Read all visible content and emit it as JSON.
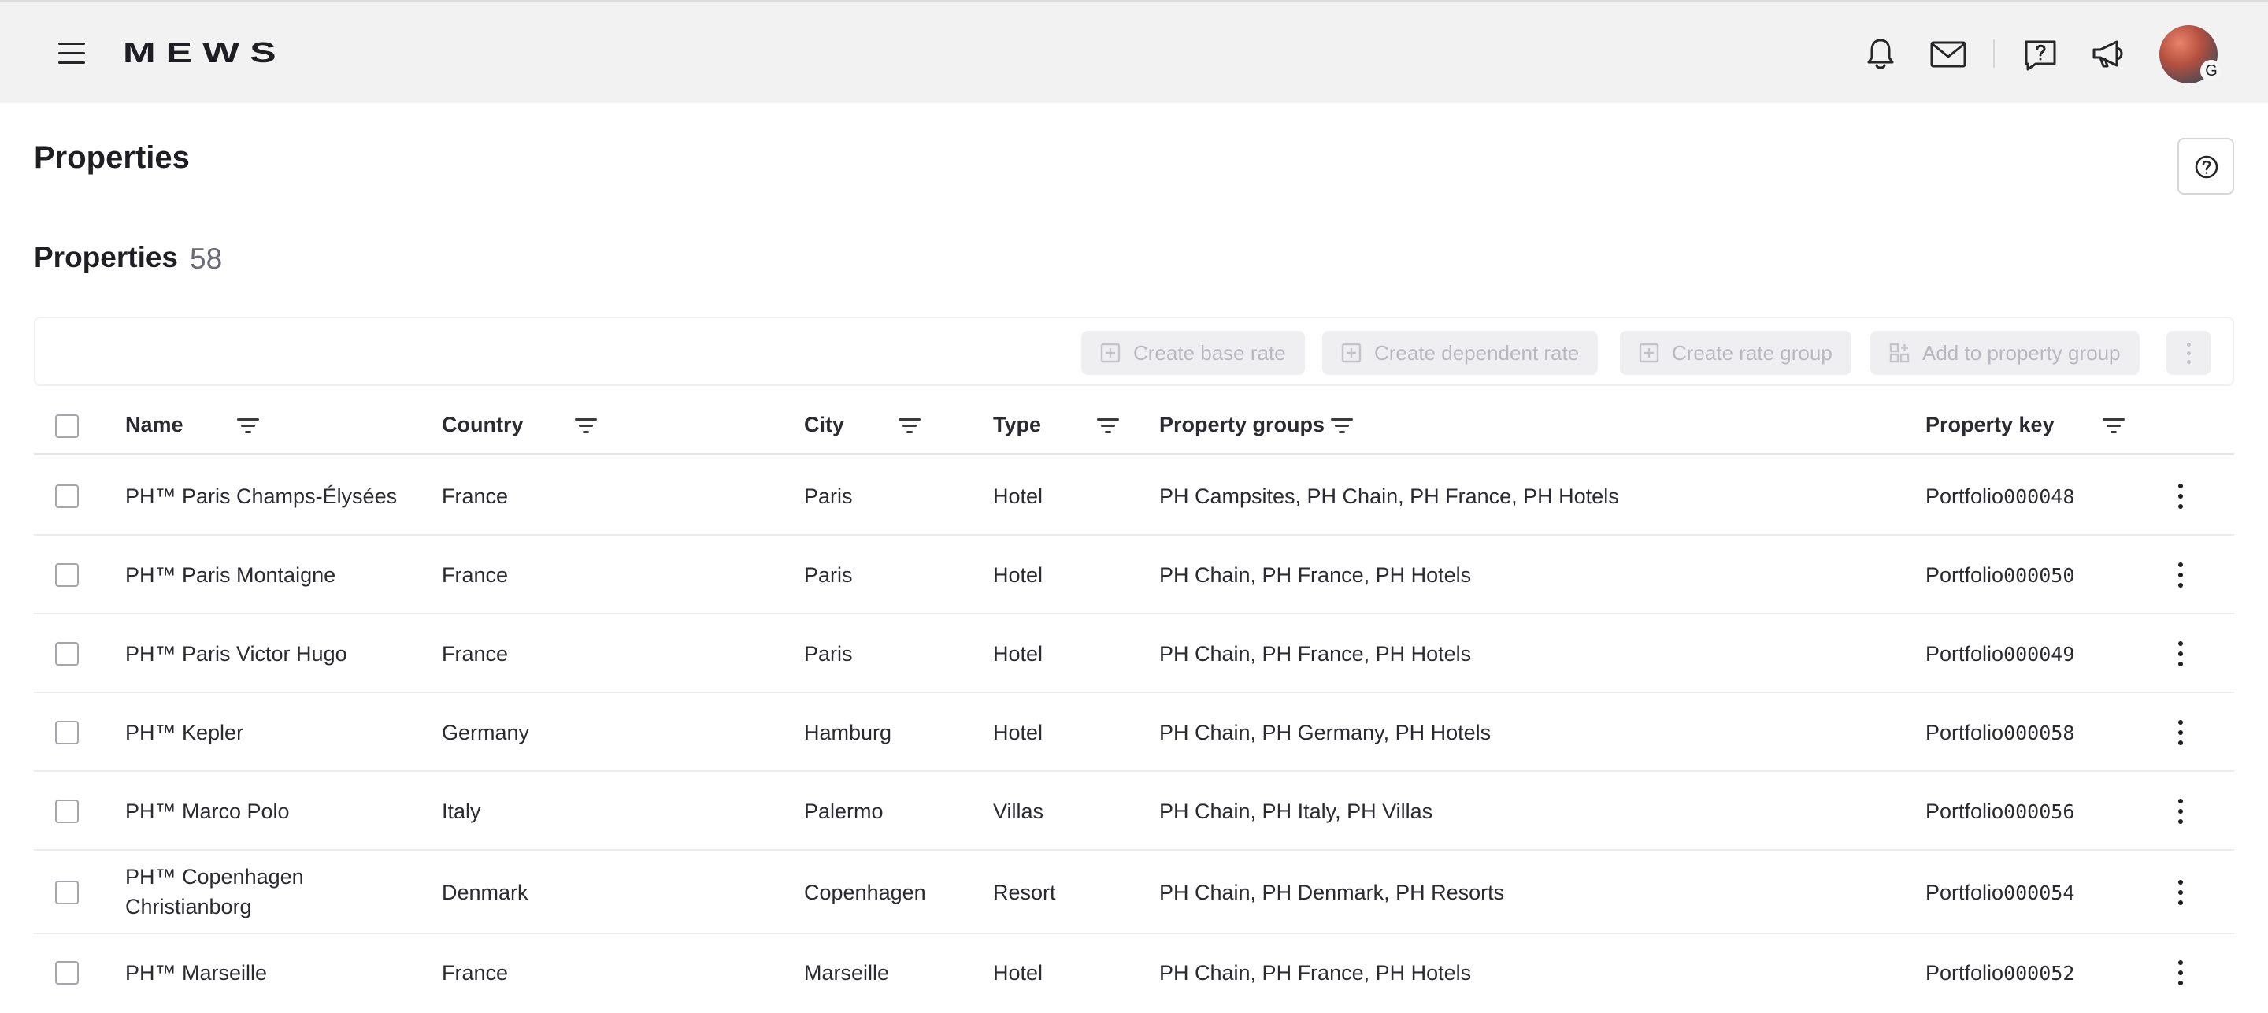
{
  "app": {
    "logo": "MEWS"
  },
  "header": {
    "icons": [
      "menu-icon",
      "bell-icon",
      "mail-icon",
      "help-chat-icon",
      "megaphone-icon"
    ],
    "avatar_badge": "G"
  },
  "page": {
    "title": "Properties"
  },
  "section": {
    "title": "Properties",
    "count": "58"
  },
  "toolbar": {
    "create_base_rate": "Create base rate",
    "create_dependent_rate": "Create dependent rate",
    "create_rate_group": "Create rate group",
    "add_to_property_group": "Add to property group"
  },
  "table": {
    "columns": {
      "name": "Name",
      "country": "Country",
      "city": "City",
      "type": "Type",
      "groups": "Property groups",
      "key": "Property key"
    },
    "rows": [
      {
        "name": "PH™ Paris Champs-Élysées",
        "country": "France",
        "city": "Paris",
        "type": "Hotel",
        "groups": "PH Campsites, PH Chain, PH France, PH Hotels",
        "key_prefix": "Portfolio",
        "key_num": "000048"
      },
      {
        "name": "PH™ Paris Montaigne",
        "country": "France",
        "city": "Paris",
        "type": "Hotel",
        "groups": "PH Chain, PH France, PH Hotels",
        "key_prefix": "Portfolio",
        "key_num": "000050"
      },
      {
        "name": "PH™ Paris Victor Hugo",
        "country": "France",
        "city": "Paris",
        "type": "Hotel",
        "groups": "PH Chain, PH France, PH Hotels",
        "key_prefix": "Portfolio",
        "key_num": "000049"
      },
      {
        "name": "PH™ Kepler",
        "country": "Germany",
        "city": "Hamburg",
        "type": "Hotel",
        "groups": "PH Chain, PH Germany, PH Hotels",
        "key_prefix": "Portfolio",
        "key_num": "000058"
      },
      {
        "name": "PH™ Marco Polo",
        "country": "Italy",
        "city": "Palermo",
        "type": "Villas",
        "groups": "PH Chain, PH Italy, PH Villas",
        "key_prefix": "Portfolio",
        "key_num": "000056"
      },
      {
        "name": "PH™ Copenhagen",
        "name_line2": "Christianborg",
        "country": "Denmark",
        "city": "Copenhagen",
        "type": "Resort",
        "groups": "PH Chain, PH Denmark, PH Resorts",
        "key_prefix": "Portfolio",
        "key_num": "000054"
      },
      {
        "name": "PH™ Marseille",
        "country": "France",
        "city": "Marseille",
        "type": "Hotel",
        "groups": "PH Chain, PH France, PH Hotels",
        "key_prefix": "Portfolio",
        "key_num": "000052"
      }
    ]
  }
}
